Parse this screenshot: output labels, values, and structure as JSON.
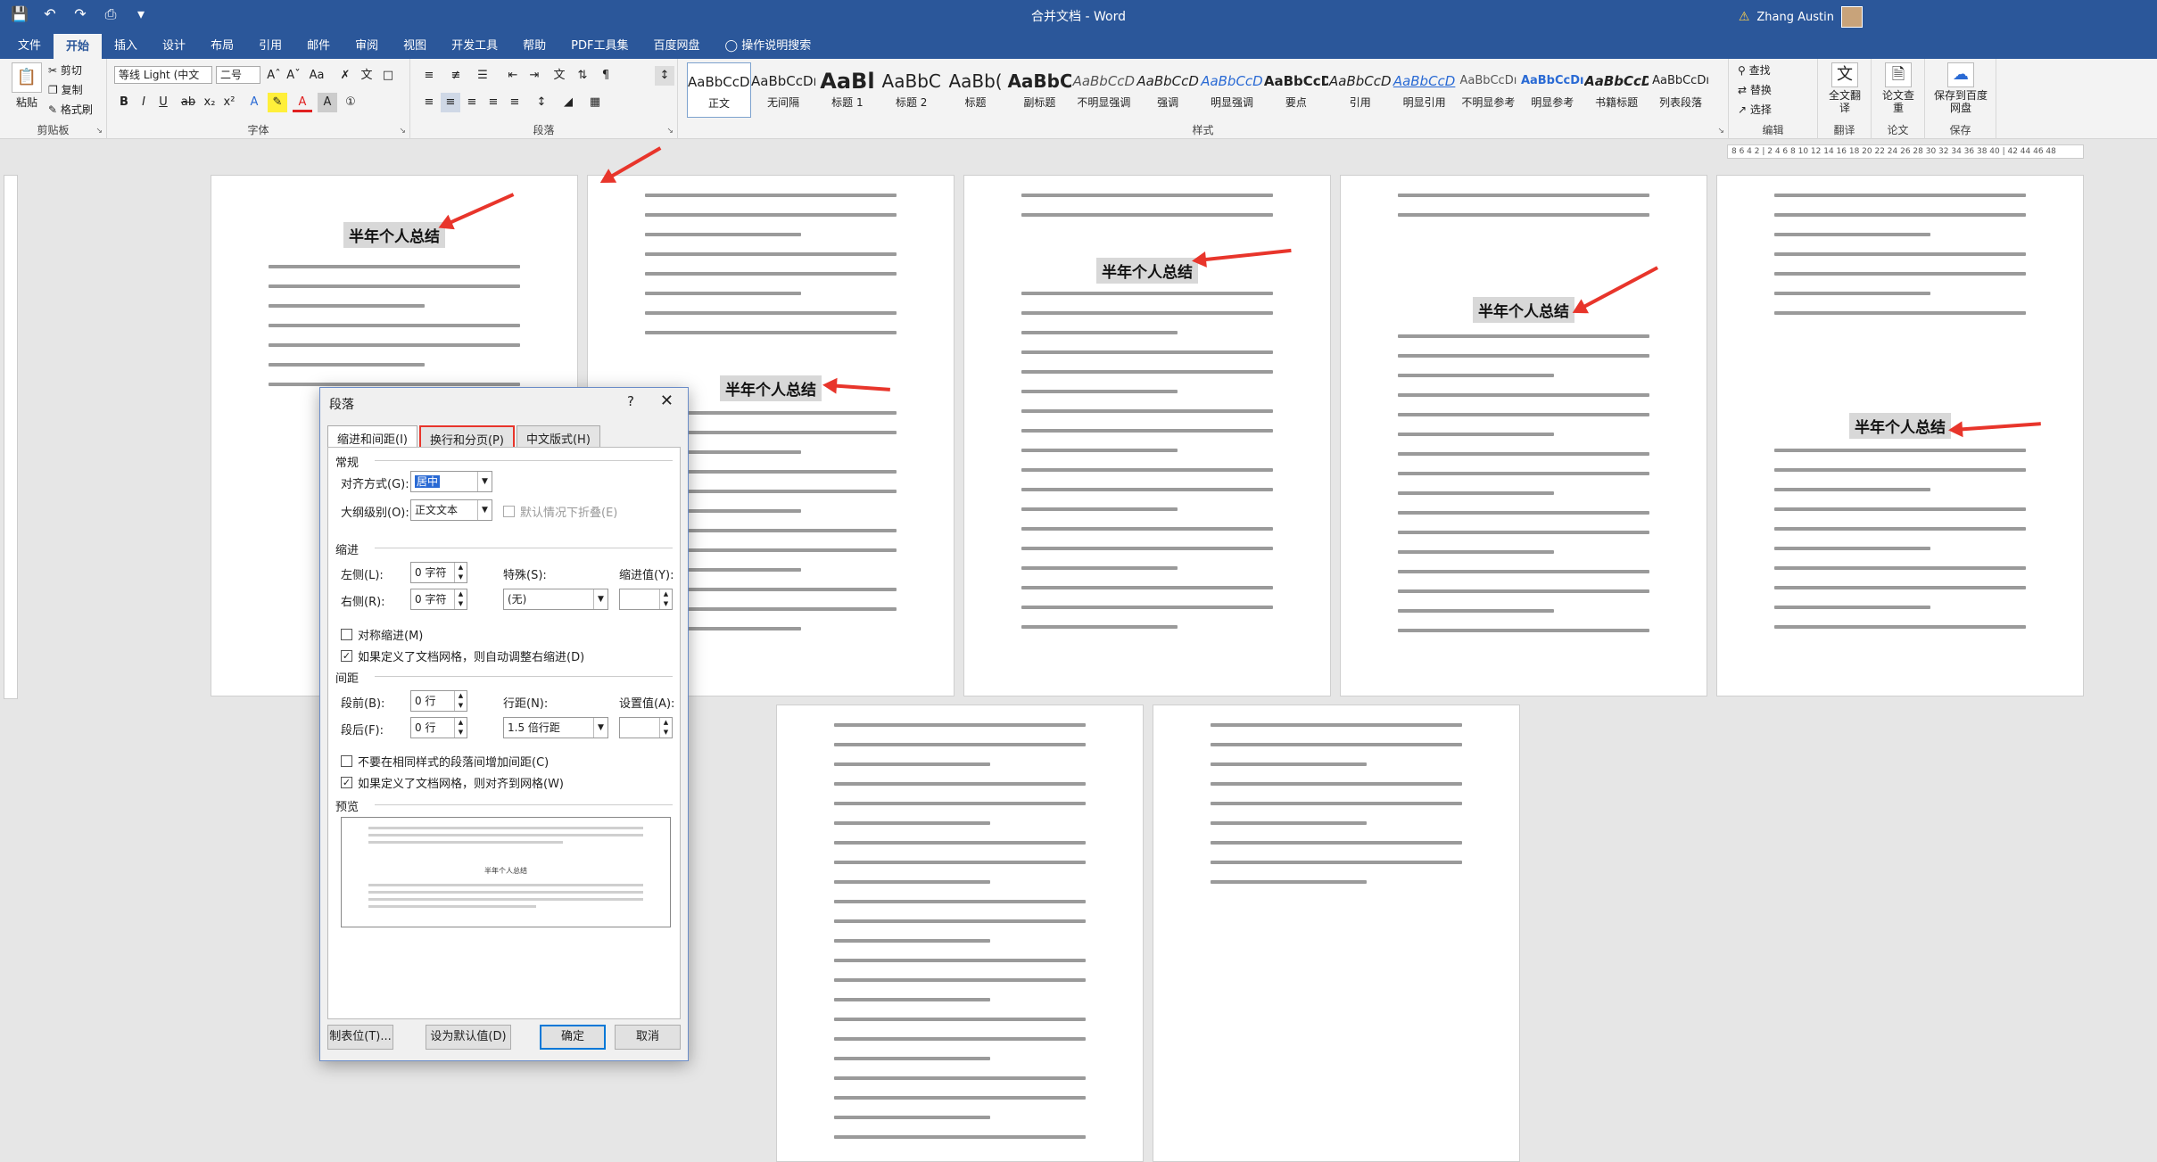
{
  "window": {
    "title": "合并文档 - Word",
    "user": "Zhang Austin"
  },
  "quick_access": {
    "save_icon": "save-icon",
    "undo_icon": "undo-icon",
    "redo_icon": "redo-icon"
  },
  "tabs": [
    "文件",
    "开始",
    "插入",
    "设计",
    "布局",
    "引用",
    "邮件",
    "审阅",
    "视图",
    "开发工具",
    "帮助",
    "PDF工具集",
    "百度网盘"
  ],
  "active_tab": "开始",
  "tell_me": "操作说明搜索",
  "ribbon": {
    "clipboard": {
      "paste": "粘贴",
      "cut": "剪切",
      "copy": "复制",
      "format_painter": "格式刷",
      "label": "剪贴板"
    },
    "font": {
      "font_name": "等线 Light (中文",
      "font_size": "二号",
      "label": "字体"
    },
    "paragraph": {
      "label": "段落"
    },
    "styles": {
      "label": "样式",
      "items": [
        {
          "sample": "AaBbCcDı",
          "name": "正文"
        },
        {
          "sample": "AaBbCcDı",
          "name": "无间隔"
        },
        {
          "sample": "AaBl",
          "name": "标题 1"
        },
        {
          "sample": "AaBbC",
          "name": "标题 2"
        },
        {
          "sample": "AaBb(",
          "name": "标题"
        },
        {
          "sample": "AaBbC",
          "name": "副标题"
        },
        {
          "sample": "AaBbCcD",
          "name": "不明显强调"
        },
        {
          "sample": "AaBbCcD",
          "name": "强调"
        },
        {
          "sample": "AaBbCcD",
          "name": "明显强调"
        },
        {
          "sample": "AaBbCcD",
          "name": "要点"
        },
        {
          "sample": "AaBbCcD",
          "name": "引用"
        },
        {
          "sample": "AaBbCcD",
          "name": "明显引用"
        },
        {
          "sample": "AaBbCcDı",
          "name": "不明显参考"
        },
        {
          "sample": "AaBbCcDı",
          "name": "明显参考"
        },
        {
          "sample": "AaBbCcD",
          "name": "书籍标题"
        },
        {
          "sample": "AaBbCcDı",
          "name": "列表段落"
        }
      ]
    },
    "editing": {
      "find": "查找",
      "replace": "替换",
      "select": "选择",
      "label": "编辑"
    },
    "translate": {
      "full": "全文翻译",
      "label": "翻译"
    },
    "paper": {
      "check": "论文查重",
      "label": "论文"
    },
    "save": {
      "baidu": "保存到百度网盘",
      "label": "保存"
    }
  },
  "ruler_text": "8 6 4 2 | 2 4 6 8 10 12 14 16 18 20 22 24 26 28 30 32 34 36 38 40 | 42 44 46 48",
  "pages": {
    "heading": "半年个人总结"
  },
  "dialog": {
    "title": "段落",
    "help": "?",
    "close": "✕",
    "tabs": [
      "缩进和间距(I)",
      "换行和分页(P)",
      "中文版式(H)"
    ],
    "general": {
      "title": "常规",
      "alignment_label": "对齐方式(G):",
      "alignment_value": "居中",
      "outline_label": "大纲级别(O):",
      "outline_value": "正文文本",
      "collapse_label": "默认情况下折叠(E)"
    },
    "indent": {
      "title": "缩进",
      "left_label": "左侧(L):",
      "left_value": "0 字符",
      "right_label": "右侧(R):",
      "right_value": "0 字符",
      "special_label": "特殊(S):",
      "special_value": "(无)",
      "by_label": "缩进值(Y):",
      "mirror_label": "对称缩进(M)",
      "auto_adjust_label": "如果定义了文档网格，则自动调整右缩进(D)"
    },
    "spacing": {
      "title": "间距",
      "before_label": "段前(B):",
      "before_value": "0 行",
      "after_label": "段后(F):",
      "after_value": "0 行",
      "line_label": "行距(N):",
      "line_value": "1.5 倍行距",
      "at_label": "设置值(A):",
      "no_space_label": "不要在相同样式的段落间增加间距(C)",
      "snap_grid_label": "如果定义了文档网格，则对齐到网格(W)"
    },
    "preview": {
      "title": "预览",
      "sample": "半年个人总结"
    },
    "buttons": {
      "tabs": "制表位(T)...",
      "default": "设为默认值(D)",
      "ok": "确定",
      "cancel": "取消"
    }
  }
}
